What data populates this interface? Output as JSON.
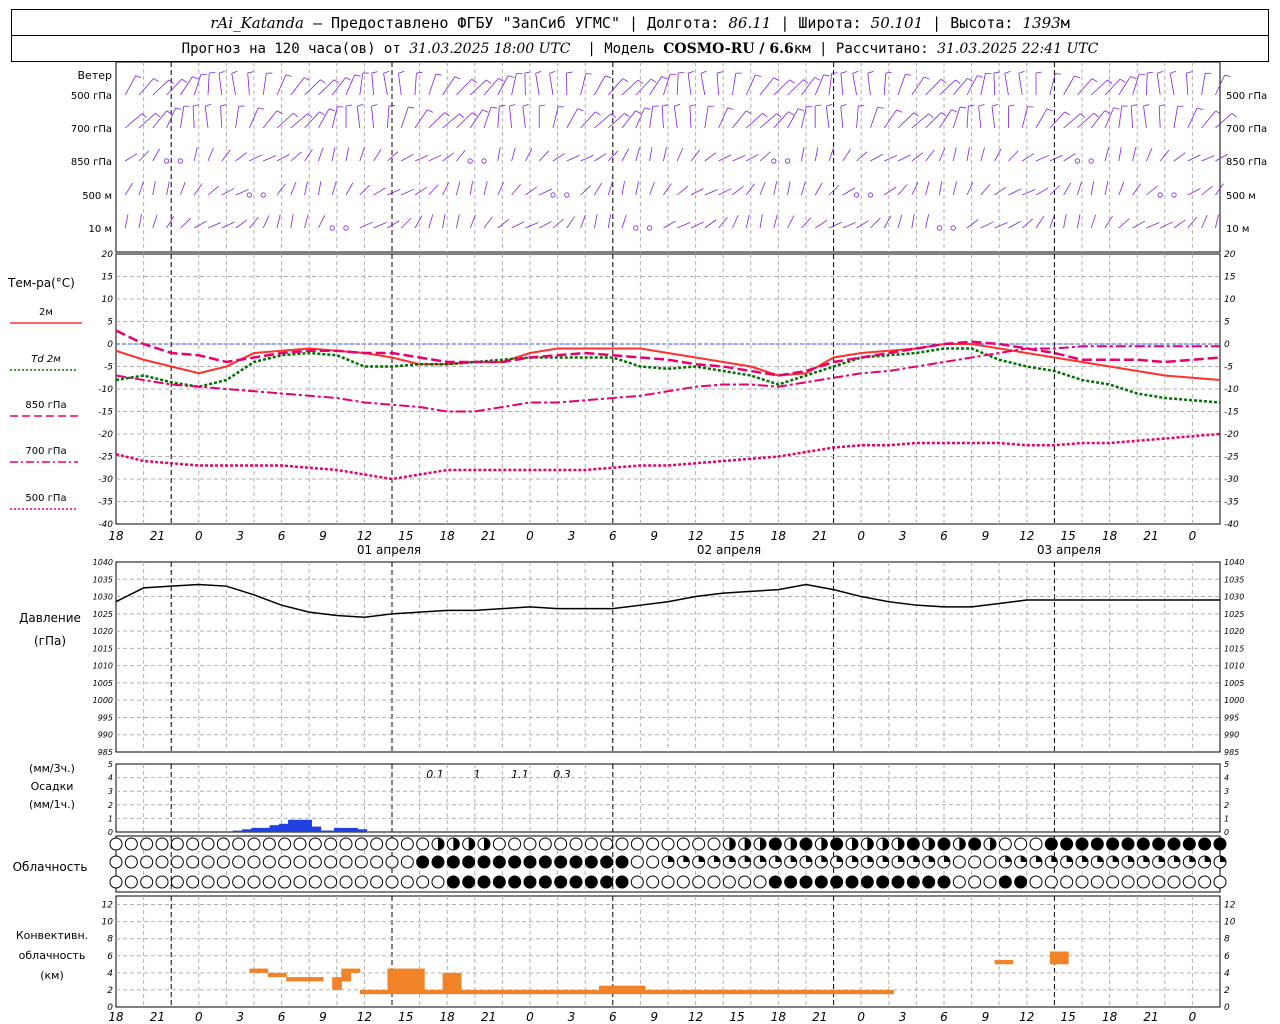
{
  "header": {
    "station": "rAi_Katanda",
    "provider": "— Предоставлено ФГБУ \"ЗапСиб УГМС\"",
    "lon_label": "Долгота:",
    "lon": "86.11",
    "lat_label": "Широта:",
    "lat": "50.101",
    "alt_label": "Высота:",
    "alt": "1393",
    "alt_unit": "м",
    "forecast_prefix": "Прогноз на 120 часа(ов) от",
    "forecast_date": "31.03.2025 18:00 UTC",
    "model_label": "Модель",
    "model": "COSMO-RU / 6.6",
    "model_unit": "км",
    "calc_label": "Рассчитано:",
    "calc_date": "31.03.2025 22:41 UTC"
  },
  "wind": {
    "title": "Ветер",
    "levels": [
      "500 гПа",
      "700 гПа",
      "850 гПа",
      "500 м",
      "10  м"
    ]
  },
  "temperature": {
    "title": "Тем-ра(°С)",
    "legend": [
      {
        "label": "2м",
        "color": "#ff3030",
        "dash": "solid"
      },
      {
        "label": "Td  2м",
        "color": "#007000",
        "dash": "dot"
      },
      {
        "label": "850 гПа",
        "color": "#e8006e",
        "dash": "dash"
      },
      {
        "label": "700 гПа",
        "color": "#e8006e",
        "dash": "dashdot"
      },
      {
        "label": "500 гПа",
        "color": "#e8006e",
        "dash": "dot"
      }
    ],
    "y_ticks": [
      "20",
      "15",
      "10",
      "5",
      "0",
      "-5",
      "-10",
      "-15",
      "-20",
      "-25",
      "-30",
      "-35",
      "-40"
    ]
  },
  "x_axis": {
    "hour_labels": [
      "18",
      "21",
      "0",
      "3",
      "6",
      "9",
      "12",
      "15",
      "18",
      "21",
      "0",
      "3",
      "6",
      "9",
      "12",
      "15",
      "18",
      "21",
      "0",
      "3",
      "6",
      "9",
      "12",
      "15",
      "18",
      "21",
      "0"
    ],
    "day_labels": [
      "01 апреля",
      "02 апреля",
      "03 апреля"
    ]
  },
  "pressure": {
    "title": "Давление",
    "unit": "(гПа)",
    "y_ticks": [
      "1040",
      "1035",
      "1030",
      "1025",
      "1020",
      "1015",
      "1010",
      "1005",
      "1000",
      "995",
      "990",
      "985"
    ]
  },
  "precip": {
    "unit3": "(мм/3ч.)",
    "title": "Осадки",
    "unit1": "(мм/1ч.)",
    "y_ticks": [
      "5",
      "4",
      "3",
      "2",
      "1",
      "0"
    ],
    "labels": [
      {
        "hour": 15,
        "text": "0.1"
      },
      {
        "hour": 18,
        "text": "1"
      },
      {
        "hour": 21,
        "text": "1.1"
      },
      {
        "hour": 24,
        "text": "0.3"
      }
    ]
  },
  "cloud": {
    "title": "Облачность"
  },
  "convective": {
    "title1": "Конвективн.",
    "title2": "облачность",
    "unit": "(км)",
    "y_ticks": [
      "12",
      "10",
      "8",
      "6",
      "4",
      "2",
      "0"
    ]
  },
  "chart_data": [
    {
      "type": "line",
      "title": "Тем-ра(°С)",
      "x_unit": "hours from 31.03.2025 18:00 UTC",
      "ylim": [
        -40,
        20
      ],
      "grid": true,
      "series": [
        {
          "name": "2м",
          "color": "#ff3030",
          "x": [
            0,
            3,
            6,
            9,
            12,
            15,
            18,
            21,
            24,
            27,
            30,
            33,
            36,
            39,
            42,
            45,
            48,
            51,
            54,
            57,
            60,
            63,
            66,
            69,
            72,
            75,
            78,
            81,
            84,
            87,
            90,
            93,
            96,
            99,
            102,
            105,
            108,
            111,
            114,
            117,
            120
          ],
          "y": [
            -1.5,
            -3.5,
            -5,
            -6.5,
            -5,
            -2,
            -1.5,
            -1,
            -1.5,
            -2,
            -3,
            -4.5,
            -4.5,
            -4,
            -4,
            -2,
            -1,
            -1,
            -1,
            -1,
            -2,
            -3,
            -4,
            -5,
            -7,
            -6.5,
            -3,
            -2,
            -1.5,
            -1,
            0,
            0,
            -1,
            -2,
            -3,
            -4,
            -5,
            -6,
            -7,
            -7.5,
            -8
          ]
        },
        {
          "name": "Td  2м",
          "color": "#007000",
          "x": [
            0,
            3,
            6,
            9,
            12,
            15,
            18,
            21,
            24,
            27,
            30,
            33,
            36,
            39,
            42,
            45,
            48,
            51,
            54,
            57,
            60,
            63,
            66,
            69,
            72,
            75,
            78,
            81,
            84,
            87,
            90,
            93,
            96,
            99,
            102,
            105,
            108,
            111,
            114,
            117,
            120
          ],
          "y": [
            -8,
            -7,
            -8.5,
            -9.5,
            -8,
            -4,
            -2.5,
            -2,
            -2.5,
            -5,
            -5,
            -4.5,
            -4.5,
            -4,
            -3.5,
            -3,
            -3,
            -3,
            -3,
            -5,
            -5.5,
            -5,
            -6,
            -7,
            -9,
            -7,
            -5,
            -3,
            -2.5,
            -2,
            -1,
            -1,
            -3.5,
            -5,
            -6,
            -8,
            -9,
            -11,
            -12,
            -12.5,
            -13
          ]
        },
        {
          "name": "850 гПа",
          "color": "#e8006e",
          "x": [
            0,
            3,
            6,
            9,
            12,
            15,
            18,
            21,
            24,
            27,
            30,
            33,
            36,
            39,
            42,
            45,
            48,
            51,
            54,
            57,
            60,
            63,
            66,
            69,
            72,
            75,
            78,
            81,
            84,
            87,
            90,
            93,
            96,
            99,
            102,
            105,
            108,
            111,
            114,
            117,
            120
          ],
          "y": [
            3,
            0,
            -2,
            -2.5,
            -4,
            -3,
            -2,
            -1.5,
            -1.5,
            -2,
            -2,
            -3,
            -4,
            -4,
            -4,
            -3,
            -2.5,
            -2,
            -2.5,
            -3,
            -3.5,
            -4.5,
            -5,
            -6,
            -7,
            -6,
            -4,
            -3,
            -2,
            -1,
            0,
            0.5,
            0,
            -1,
            -2,
            -3.5,
            -3.5,
            -3.5,
            -4,
            -3.5,
            -3
          ]
        },
        {
          "name": "700 гПа",
          "color": "#e8006e",
          "x": [
            0,
            3,
            6,
            9,
            12,
            15,
            18,
            21,
            24,
            27,
            30,
            33,
            36,
            39,
            42,
            45,
            48,
            51,
            54,
            57,
            60,
            63,
            66,
            69,
            72,
            75,
            78,
            81,
            84,
            87,
            90,
            93,
            96,
            99,
            102,
            105,
            108,
            111,
            114,
            117,
            120
          ],
          "y": [
            -7,
            -8,
            -9,
            -9.5,
            -10,
            -10.5,
            -11,
            -11.5,
            -12,
            -13,
            -13.5,
            -14,
            -15,
            -15,
            -14,
            -13,
            -13,
            -12.5,
            -12,
            -11.5,
            -10.5,
            -9.5,
            -9,
            -9,
            -9.5,
            -8.5,
            -7.5,
            -6.5,
            -6,
            -5,
            -4,
            -3,
            -2,
            -1,
            -1,
            -0.5,
            -0.5,
            -0.5,
            -0.5,
            -0.5,
            -0.5
          ]
        },
        {
          "name": "500 гПа",
          "color": "#e8006e",
          "x": [
            0,
            3,
            6,
            9,
            12,
            15,
            18,
            21,
            24,
            27,
            30,
            33,
            36,
            39,
            42,
            45,
            48,
            51,
            54,
            57,
            60,
            63,
            66,
            69,
            72,
            75,
            78,
            81,
            84,
            87,
            90,
            93,
            96,
            99,
            102,
            105,
            108,
            111,
            114,
            117,
            120
          ],
          "y": [
            -24.5,
            -26,
            -26.5,
            -27,
            -27,
            -27,
            -27,
            -27.5,
            -28,
            -29,
            -30,
            -29,
            -28,
            -28,
            -28,
            -28,
            -28,
            -28,
            -27.5,
            -27,
            -27,
            -26.5,
            -26,
            -25.5,
            -25,
            -24,
            -23,
            -22.5,
            -22.5,
            -22,
            -22,
            -22,
            -22,
            -22.5,
            -22.5,
            -22,
            -22,
            -21.5,
            -21,
            -20.5,
            -20
          ]
        }
      ]
    },
    {
      "type": "line",
      "title": "Давление",
      "ylim": [
        985,
        1040
      ],
      "grid": true,
      "series": [
        {
          "name": "Давление",
          "color": "#000000",
          "x": [
            0,
            3,
            6,
            9,
            12,
            15,
            18,
            21,
            24,
            27,
            30,
            33,
            36,
            39,
            42,
            45,
            48,
            51,
            54,
            57,
            60,
            63,
            66,
            69,
            72,
            75,
            78,
            81,
            84,
            87,
            90,
            93,
            96,
            99,
            102,
            105,
            108,
            111,
            114,
            117,
            120
          ],
          "y": [
            1028.5,
            1032.5,
            1033,
            1033.5,
            1033,
            1030.5,
            1027.5,
            1025.5,
            1024.5,
            1024,
            1025,
            1025.5,
            1026,
            1026,
            1026.5,
            1027,
            1026.5,
            1026.5,
            1026.5,
            1027.5,
            1028.5,
            1030,
            1031,
            1031.5,
            1032,
            1033.5,
            1032,
            1030,
            1028.5,
            1027.5,
            1027,
            1027,
            1028,
            1029,
            1029,
            1029,
            1029,
            1029,
            1029,
            1029,
            1029
          ]
        }
      ]
    },
    {
      "type": "bar",
      "title": "Осадки",
      "ylim": [
        0,
        5
      ],
      "series": [
        {
          "name": "мм/1ч.",
          "color": "#2040e0",
          "x": [
            14,
            15,
            16,
            17,
            18,
            19,
            20,
            21,
            22,
            23,
            24,
            25,
            26,
            27
          ],
          "y": [
            0.1,
            0.2,
            0.3,
            0.3,
            0.5,
            0.6,
            0.9,
            0.4,
            0.1,
            0.1,
            0.1,
            0.3,
            0.2,
            0.0
          ]
        }
      ]
    },
    {
      "type": "bar",
      "title": "Конвективн. облачность",
      "ylim": [
        0,
        13
      ],
      "series": [
        {
          "name": "облачность",
          "color": "#f08228",
          "x": [
            15,
            16,
            17,
            18,
            19,
            20,
            21,
            22,
            24,
            25,
            26,
            27,
            28,
            29,
            30,
            31,
            32,
            33,
            34,
            35,
            36,
            37,
            38,
            39,
            40,
            41,
            42,
            43,
            44,
            45,
            46,
            47,
            48,
            49,
            50,
            51,
            52,
            53,
            54,
            55,
            56,
            57,
            58,
            59,
            60,
            61,
            62,
            63,
            64,
            65,
            66,
            67,
            68,
            69,
            70,
            71,
            72,
            73,
            74,
            75,
            76,
            77,
            78,
            79,
            80,
            81,
            82,
            83,
            84,
            96,
            97,
            102,
            103
          ],
          "bottom": [
            4,
            4,
            3.5,
            3.5,
            3,
            3,
            3,
            3,
            2,
            3,
            4,
            1.5,
            1.5,
            1.5,
            1.5,
            1.5,
            1.5,
            1.5,
            1.5,
            1.5,
            1.5,
            1.5,
            1.5,
            1.5,
            1.5,
            1.5,
            1.5,
            1.5,
            1.5,
            1.5,
            1.5,
            1.5,
            1.5,
            1.5,
            1.5,
            1.5,
            1.5,
            1.5,
            1.5,
            1.5,
            1.5,
            1.5,
            1.5,
            1.5,
            1.5,
            1.5,
            1.5,
            1.5,
            1.5,
            1.5,
            1.5,
            1.5,
            1.5,
            1.5,
            1.5,
            1.5,
            1.5,
            1.5,
            1.5,
            1.5,
            1.5,
            1.5,
            1.5,
            1.5,
            1.5,
            1.5,
            1.5,
            1.5,
            1.5,
            5,
            5,
            5,
            5
          ],
          "top": [
            4.5,
            4.5,
            4,
            4,
            3.5,
            3.5,
            3.5,
            3.5,
            3.5,
            4.5,
            4.5,
            2,
            2,
            2,
            4.5,
            4.5,
            4.5,
            4.5,
            2,
            2,
            4,
            4,
            2,
            2,
            2,
            2,
            2,
            2,
            2,
            2,
            2,
            2,
            2,
            2,
            2,
            2,
            2,
            2.5,
            2.5,
            2.5,
            2.5,
            2.5,
            2,
            2,
            2,
            2,
            2,
            2,
            2,
            2,
            2,
            2,
            2,
            2,
            2,
            2,
            2,
            2,
            2,
            2,
            2,
            2,
            2,
            2,
            2,
            2,
            2,
            2,
            2,
            5.5,
            5.5,
            6.5,
            6.5
          ]
        }
      ]
    }
  ]
}
